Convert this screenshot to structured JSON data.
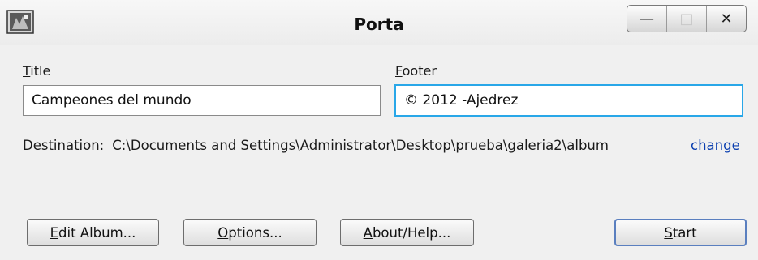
{
  "window": {
    "title": "Porta",
    "icon": "app-icon",
    "controls": {
      "minimize": "—",
      "maximize": "□",
      "close": "✕"
    }
  },
  "form": {
    "title_label_first": "T",
    "title_label_rest": "itle",
    "title_value": "Campeones del mundo",
    "footer_label_first": "F",
    "footer_label_rest": "ooter",
    "footer_value": "© 2012 -Ajedrez",
    "destination_label": "Destination:",
    "destination_value": "C:\\Documents and Settings\\Administrator\\Desktop\\prueba\\galeria2\\album",
    "change_link": "change"
  },
  "buttons": {
    "edit_album_first": "E",
    "edit_album_rest": "dit Album...",
    "options_first": "O",
    "options_rest": "ptions...",
    "about_first": "A",
    "about_rest": "bout/Help...",
    "start_first": "S",
    "start_rest": "tart"
  },
  "colors": {
    "focus_border": "#29a7e8",
    "link": "#0b3fb0"
  }
}
